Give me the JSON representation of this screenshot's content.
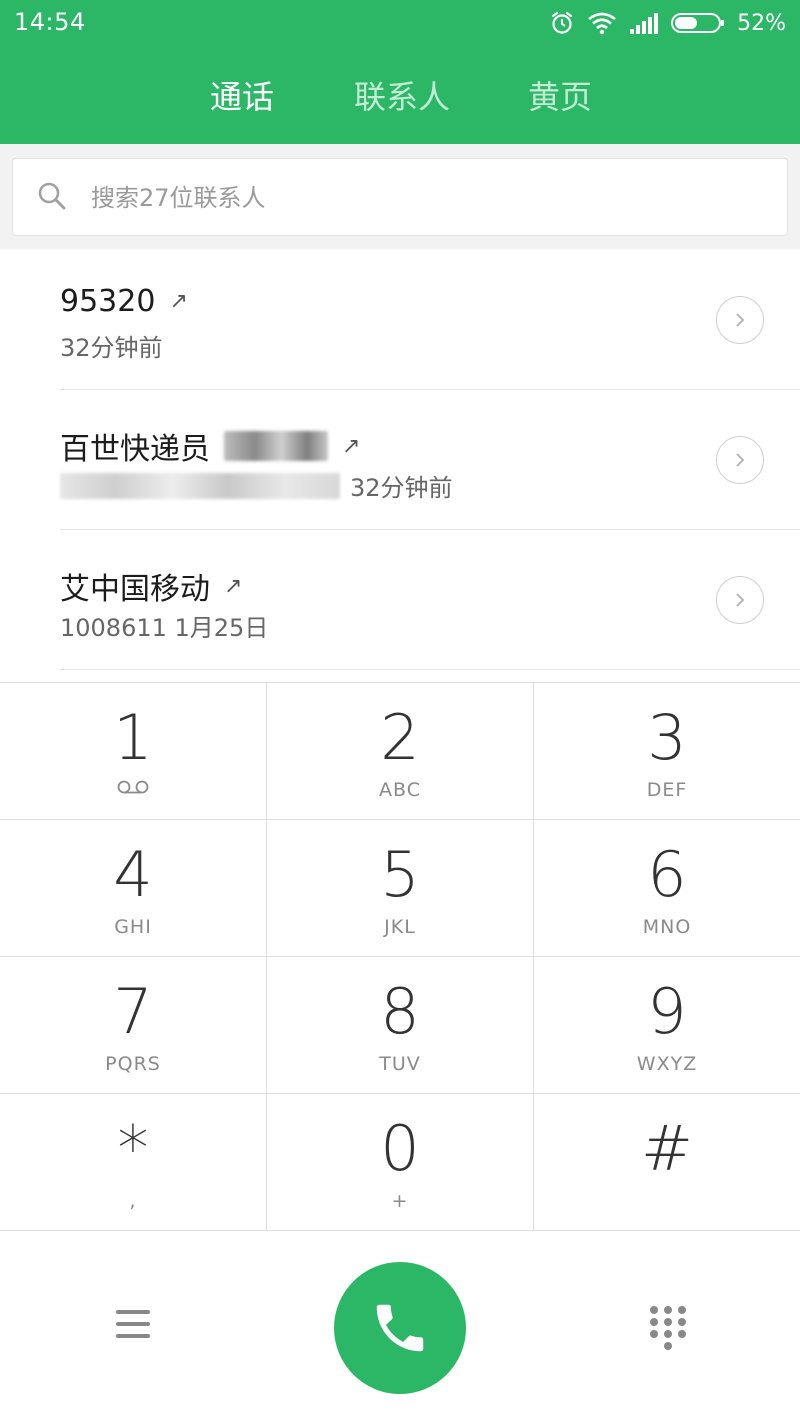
{
  "status_bar": {
    "time": "14:54",
    "battery_percent": "52%",
    "battery_level": 0.52,
    "icons": [
      "alarm-icon",
      "wifi-icon",
      "signal-icon",
      "battery-icon"
    ]
  },
  "tabs": [
    {
      "label": "通话",
      "active": true
    },
    {
      "label": "联系人",
      "active": false
    },
    {
      "label": "黄页",
      "active": false
    }
  ],
  "search": {
    "placeholder": "搜索27位联系人"
  },
  "calls": [
    {
      "name": "95320",
      "sub": "32分钟前",
      "direction": "outgoing"
    },
    {
      "name": "百世快递员",
      "sub": "32分钟前",
      "direction": "outgoing",
      "redacted": true
    },
    {
      "name": "艾中国移动",
      "sub": "1008611 1月25日",
      "direction": "outgoing"
    }
  ],
  "call_arrow": "↗",
  "dialpad": [
    {
      "digit": "1",
      "letters": "",
      "icon": "voicemail-icon"
    },
    {
      "digit": "2",
      "letters": "ABC"
    },
    {
      "digit": "3",
      "letters": "DEF"
    },
    {
      "digit": "4",
      "letters": "GHI"
    },
    {
      "digit": "5",
      "letters": "JKL"
    },
    {
      "digit": "6",
      "letters": "MNO"
    },
    {
      "digit": "7",
      "letters": "PQRS"
    },
    {
      "digit": "8",
      "letters": "TUV"
    },
    {
      "digit": "9",
      "letters": "WXYZ"
    },
    {
      "digit": "*",
      "letters": ","
    },
    {
      "digit": "0",
      "letters": "+"
    },
    {
      "digit": "#",
      "letters": ""
    }
  ],
  "colors": {
    "accent": "#2bb766",
    "divider": "#dedede"
  }
}
